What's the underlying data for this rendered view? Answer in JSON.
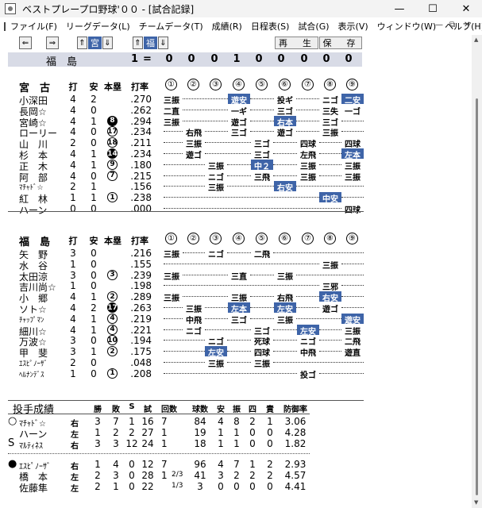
{
  "window": {
    "title": "ベストプレープロ野球'００ - [試合記録]"
  },
  "menu": [
    "ファイル(F)",
    "リーグデータ(L)",
    "チームデータ(T)",
    "成績(R)",
    "日程表(S)",
    "試合(G)",
    "表示(V)",
    "ウィンドウ(W)",
    "ヘルプ(H)"
  ],
  "toolbar": {
    "home": "宮",
    "away": "福",
    "replay": "再　生",
    "save": "保　存"
  },
  "scoreline": {
    "team": "福　島",
    "inning": "1",
    "eq": "=",
    "innings": [
      "0",
      "0",
      "0",
      "1",
      "0",
      "0",
      "0",
      "0",
      "0"
    ]
  },
  "inning_marks": [
    "①",
    "②",
    "③",
    "④",
    "⑤",
    "⑥",
    "⑦",
    "⑧",
    "⑨"
  ],
  "teams": [
    {
      "name": "宮　古",
      "headers": {
        "ab": "打",
        "h": "安",
        "hr": "本塁",
        "avg": "打率"
      },
      "rows": [
        {
          "name": "小深田",
          "ab": "4",
          "h": "2",
          "hr": "",
          "hrfill": false,
          "avg": ".270",
          "res": [
            {
              "i": 0,
              "t": "三振"
            },
            {
              "i": 3,
              "t": "遊安",
              "hl": true
            },
            {
              "i": 5,
              "t": "投ギ"
            },
            {
              "i": 7,
              "t": "ニゴ"
            },
            {
              "i": 8,
              "t": "二安",
              "hl": true
            }
          ]
        },
        {
          "name": "長岡☆",
          "ab": "4",
          "h": "0",
          "hr": "",
          "hrfill": false,
          "avg": ".262",
          "res": [
            {
              "i": 0,
              "t": "二直"
            },
            {
              "i": 3,
              "t": "一ギ"
            },
            {
              "i": 5,
              "t": "三ゴ"
            },
            {
              "i": 7,
              "t": "三失"
            },
            {
              "i": 8,
              "t": "一ゴ"
            }
          ]
        },
        {
          "name": "宮崎☆",
          "ab": "4",
          "h": "1",
          "hr": "8",
          "hrfill": true,
          "avg": ".294",
          "res": [
            {
              "i": 0,
              "t": "三振"
            },
            {
              "i": 3,
              "t": "遊ゴ"
            },
            {
              "i": 5,
              "t": "右本",
              "hl": true
            },
            {
              "i": 7,
              "t": "三ゴ"
            }
          ]
        },
        {
          "name": "ローリー",
          "ab": "4",
          "h": "0",
          "hr": "17",
          "hrfill": false,
          "avg": ".234",
          "res": [
            {
              "i": 1,
              "t": "右飛"
            },
            {
              "i": 3,
              "t": "三ゴ"
            },
            {
              "i": 5,
              "t": "遊ゴ"
            },
            {
              "i": 7,
              "t": "三振"
            }
          ]
        },
        {
          "name": "山　川",
          "ab": "2",
          "h": "0",
          "hr": "18",
          "hrfill": false,
          "avg": ".211",
          "res": [
            {
              "i": 1,
              "t": "三振"
            },
            {
              "i": 4,
              "t": "三ゴ"
            },
            {
              "i": 6,
              "t": "四球"
            },
            {
              "i": 8,
              "t": "四球"
            }
          ]
        },
        {
          "name": "杉　本",
          "ab": "4",
          "h": "1",
          "hr": "14",
          "hrfill": true,
          "avg": ".234",
          "res": [
            {
              "i": 1,
              "t": "遊ゴ"
            },
            {
              "i": 4,
              "t": "三ゴ"
            },
            {
              "i": 6,
              "t": "左飛"
            },
            {
              "i": 8,
              "t": "左本",
              "hl": true
            }
          ]
        },
        {
          "name": "正　木",
          "ab": "4",
          "h": "1",
          "hr": "9",
          "hrfill": false,
          "avg": ".180",
          "res": [
            {
              "i": 2,
              "t": "三振"
            },
            {
              "i": 4,
              "t": "中２",
              "hl": true
            },
            {
              "i": 6,
              "t": "三振"
            },
            {
              "i": 8,
              "t": "三振"
            }
          ]
        },
        {
          "name": "阿　部",
          "ab": "4",
          "h": "0",
          "hr": "7",
          "hrfill": false,
          "avg": ".215",
          "res": [
            {
              "i": 2,
              "t": "ニゴ"
            },
            {
              "i": 4,
              "t": "三飛"
            },
            {
              "i": 6,
              "t": "三振"
            },
            {
              "i": 8,
              "t": "三振"
            }
          ]
        },
        {
          "name": "ﾏﾁｬﾄﾞ☆",
          "ab": "2",
          "h": "1",
          "hr": "",
          "hrfill": false,
          "avg": ".156",
          "res": [
            {
              "i": 2,
              "t": "三振"
            },
            {
              "i": 5,
              "t": "右安",
              "hl": true
            }
          ]
        },
        {
          "name": "紅　林",
          "ab": "1",
          "h": "1",
          "hr": "1",
          "hrfill": false,
          "avg": ".238",
          "res": [
            {
              "i": 7,
              "t": "中安",
              "hl": true
            }
          ]
        },
        {
          "name": "ハーン",
          "ab": "0",
          "h": "0",
          "hr": "",
          "hrfill": false,
          "avg": ".000",
          "res": [
            {
              "i": 8,
              "t": "四球"
            }
          ]
        }
      ]
    },
    {
      "name": "福　島",
      "headers": {
        "ab": "打",
        "h": "安",
        "hr": "本塁",
        "avg": "打率"
      },
      "rows": [
        {
          "name": "矢　野",
          "ab": "3",
          "h": "0",
          "hr": "",
          "hrfill": false,
          "avg": ".216",
          "res": [
            {
              "i": 0,
              "t": "三振"
            },
            {
              "i": 2,
              "t": "ニゴ"
            },
            {
              "i": 4,
              "t": "二飛"
            }
          ]
        },
        {
          "name": "水　谷",
          "ab": "1",
          "h": "0",
          "hr": "",
          "hrfill": false,
          "avg": ".155",
          "res": [
            {
              "i": 7,
              "t": "三振"
            }
          ]
        },
        {
          "name": "太田涼",
          "ab": "3",
          "h": "0",
          "hr": "3",
          "hrfill": false,
          "avg": ".239",
          "res": [
            {
              "i": 0,
              "t": "三振"
            },
            {
              "i": 3,
              "t": "三直"
            },
            {
              "i": 5,
              "t": "三振"
            }
          ]
        },
        {
          "name": "吉川尚☆",
          "ab": "1",
          "h": "0",
          "hr": "",
          "hrfill": false,
          "avg": ".198",
          "res": [
            {
              "i": 7,
              "t": "三邪"
            }
          ]
        },
        {
          "name": "小　郷",
          "ab": "4",
          "h": "1",
          "hr": "2",
          "hrfill": false,
          "avg": ".289",
          "res": [
            {
              "i": 0,
              "t": "三振"
            },
            {
              "i": 3,
              "t": "三振"
            },
            {
              "i": 5,
              "t": "右飛"
            },
            {
              "i": 7,
              "t": "右安",
              "hl": true
            }
          ]
        },
        {
          "name": "ソト☆",
          "ab": "4",
          "h": "2",
          "hr": "17",
          "hrfill": true,
          "avg": ".263",
          "res": [
            {
              "i": 1,
              "t": "三振"
            },
            {
              "i": 3,
              "t": "左本",
              "hl": true
            },
            {
              "i": 5,
              "t": "左安",
              "hl": true
            },
            {
              "i": 7,
              "t": "遊ゴ"
            }
          ]
        },
        {
          "name": "ﾁｬｯﾌﾟﾏﾝ",
          "ab": "4",
          "h": "1",
          "hr": "4",
          "hrfill": false,
          "avg": ".219",
          "res": [
            {
              "i": 1,
              "t": "中飛"
            },
            {
              "i": 3,
              "t": "三ゴ"
            },
            {
              "i": 5,
              "t": "三振"
            },
            {
              "i": 8,
              "t": "遊安",
              "hl": true
            }
          ]
        },
        {
          "name": "細川☆",
          "ab": "4",
          "h": "1",
          "hr": "4",
          "hrfill": false,
          "avg": ".221",
          "res": [
            {
              "i": 1,
              "t": "ニゴ"
            },
            {
              "i": 4,
              "t": "三ゴ"
            },
            {
              "i": 6,
              "t": "左安",
              "hl": true
            },
            {
              "i": 8,
              "t": "三振"
            }
          ]
        },
        {
          "name": "万波☆",
          "ab": "3",
          "h": "0",
          "hr": "10",
          "hrfill": false,
          "avg": ".194",
          "res": [
            {
              "i": 2,
              "t": "ニゴ"
            },
            {
              "i": 4,
              "t": "死球"
            },
            {
              "i": 6,
              "t": "ニゴ"
            },
            {
              "i": 8,
              "t": "二飛"
            }
          ]
        },
        {
          "name": "甲　斐",
          "ab": "3",
          "h": "1",
          "hr": "2",
          "hrfill": false,
          "avg": ".175",
          "res": [
            {
              "i": 2,
              "t": "左安",
              "hl": true
            },
            {
              "i": 4,
              "t": "四球"
            },
            {
              "i": 6,
              "t": "中飛"
            },
            {
              "i": 8,
              "t": "遊直"
            }
          ]
        },
        {
          "name": "ｴｽﾋﾟﾉｰｻﾞ",
          "ab": "2",
          "h": "0",
          "hr": "",
          "hrfill": false,
          "avg": ".048",
          "res": [
            {
              "i": 2,
              "t": "三振"
            },
            {
              "i": 4,
              "t": "三振"
            }
          ]
        },
        {
          "name": "ﾍﾙﾅﾝﾃﾞｽ",
          "ab": "1",
          "h": "0",
          "hr": "1",
          "hrfill": false,
          "avg": ".208",
          "res": [
            {
              "i": 6,
              "t": "投ゴ"
            }
          ]
        }
      ]
    }
  ],
  "pitching": {
    "title": "投手成績",
    "headers": [
      "勝",
      "敗",
      "S",
      "試",
      "回数",
      "球数",
      "安",
      "振",
      "四",
      "責",
      "防御率"
    ],
    "groups": [
      [
        {
          "mark": "○",
          "name": "ﾏﾁｬﾄﾞ☆",
          "hand": "右",
          "w": "3",
          "l": "7",
          "s": "1",
          "g": "16",
          "ip": "7",
          "frac": "",
          "np": "84",
          "h": "4",
          "so": "8",
          "bb": "2",
          "er": "1",
          "era": "3.06"
        },
        {
          "mark": "",
          "name": "ハーン",
          "hand": "左",
          "w": "1",
          "l": "2",
          "s": "2",
          "g": "27",
          "ip": "1",
          "frac": "",
          "np": "19",
          "h": "1",
          "so": "1",
          "bb": "0",
          "er": "0",
          "era": "4.28"
        },
        {
          "mark": "S",
          "name": "ﾏﾙﾃｨﾈｽ",
          "hand": "右",
          "w": "3",
          "l": "3",
          "s": "12",
          "g": "24",
          "ip": "1",
          "frac": "",
          "np": "18",
          "h": "1",
          "so": "1",
          "bb": "0",
          "er": "0",
          "era": "1.82"
        }
      ],
      [
        {
          "mark": "●",
          "name": "ｴｽﾋﾟﾉｰｻﾞ",
          "hand": "右",
          "w": "1",
          "l": "4",
          "s": "0",
          "g": "12",
          "ip": "7",
          "frac": "",
          "np": "96",
          "h": "4",
          "so": "7",
          "bb": "1",
          "er": "2",
          "era": "2.93"
        },
        {
          "mark": "",
          "name": "橋　本",
          "hand": "左",
          "w": "2",
          "l": "3",
          "s": "0",
          "g": "28",
          "ip": "1",
          "frac": "2/3",
          "np": "41",
          "h": "3",
          "so": "2",
          "bb": "2",
          "er": "2",
          "era": "4.57"
        },
        {
          "mark": "",
          "name": "佐藤隼",
          "hand": "左",
          "w": "2",
          "l": "1",
          "s": "0",
          "g": "22",
          "ip": "",
          "frac": "1/3",
          "np": "3",
          "h": "0",
          "so": "0",
          "bb": "0",
          "er": "0",
          "era": "4.41"
        }
      ]
    ]
  }
}
